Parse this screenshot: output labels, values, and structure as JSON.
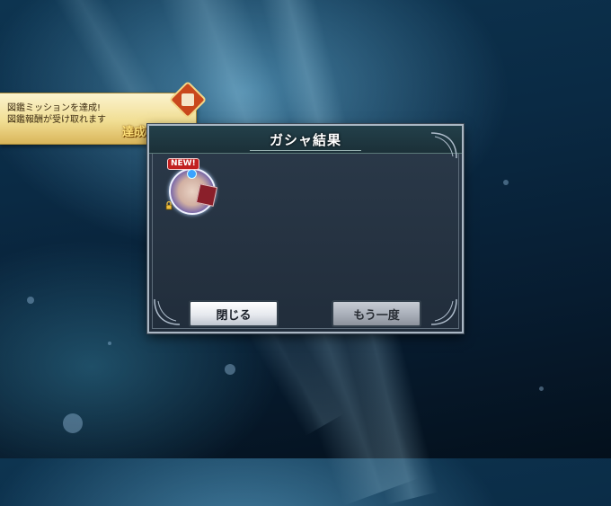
{
  "notification": {
    "line1": "図鑑ミッションを達成!",
    "line2": "図鑑報酬が受け取れます",
    "achieved_label": "達成!",
    "icons": [
      "mission-badge-icon",
      "crown-icon"
    ]
  },
  "dialog": {
    "title": "ガシャ結果",
    "results": [
      {
        "badge": "NEW!",
        "icons": [
          "gem-icon",
          "lock-icon",
          "book-icon"
        ]
      }
    ],
    "buttons": {
      "close_label": "閉じる",
      "again_label": "もう一度"
    }
  },
  "colors": {
    "notification_gold": "#f1de93",
    "new_badge_red": "#c22020",
    "dialog_bg": "#212d3b"
  }
}
